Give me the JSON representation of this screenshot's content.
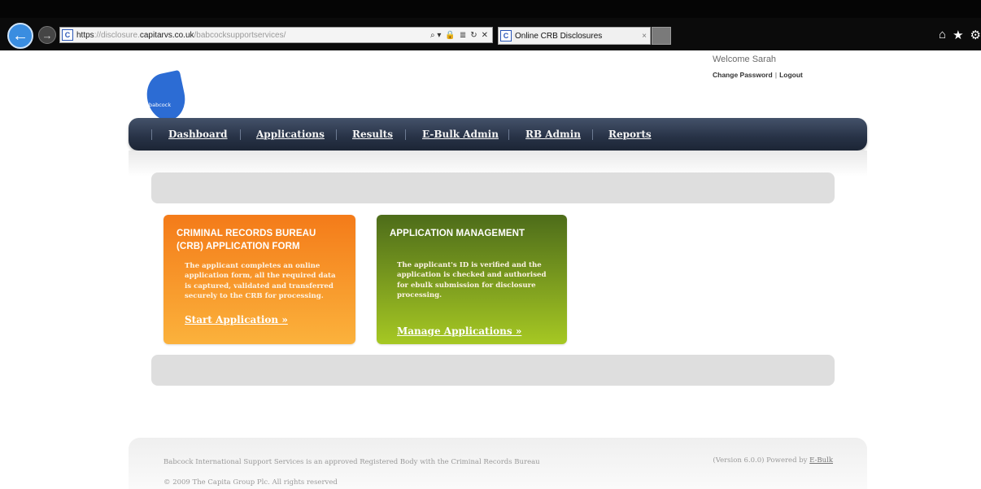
{
  "browser": {
    "url_scheme": "https",
    "url_host_faded": "://disclosure.",
    "url_host": "capitarvs.co.uk",
    "url_path": "/babcocksupportservices/",
    "tab_title": "Online CRB Disclosures",
    "tab_close": "×",
    "site_icon": "C",
    "tools": [
      "⌕ ▾",
      "🔒",
      "≣",
      "↻",
      "✕"
    ],
    "right_icons": [
      "⌂",
      "★",
      "⚙"
    ]
  },
  "header": {
    "welcome": "Welcome Sarah",
    "change_password": "Change Password",
    "separator": "|",
    "logout": "Logout",
    "logo_text": "babcock"
  },
  "nav": {
    "items": [
      "Dashboard",
      "Applications",
      "Results",
      "E-Bulk Admin",
      "RB Admin",
      "Reports"
    ]
  },
  "cards": {
    "crb": {
      "title_line1": "CRIMINAL RECORDS BUREAU",
      "title_line2": "(CRB) APPLICATION FORM",
      "body": [
        "The applicant completes an online",
        "application form, all the required data",
        "is captured, validated and transferred",
        "securely to the CRB for processing."
      ],
      "link": "Start Application »",
      "color_top": "#f47b19",
      "color_bottom": "#fbb23c"
    },
    "app": {
      "title": "APPLICATION MANAGEMENT",
      "body": [
        "The applicant's ID is verified and the",
        "application is checked and authorised",
        "for ebulk submission for disclosure",
        "processing."
      ],
      "link": "Manage Applications »",
      "color_top": "#4d6c1a",
      "color_bottom": "#a6c823"
    }
  },
  "footer": {
    "statement": "Babcock International Support Services is an approved Registered Body with the Criminal Records Bureau",
    "copyright": "© 2009 The Capita Group Plc. All rights reserved",
    "version": "(Version 6.0.0) Powered by",
    "powered_link": "E-Bulk"
  }
}
